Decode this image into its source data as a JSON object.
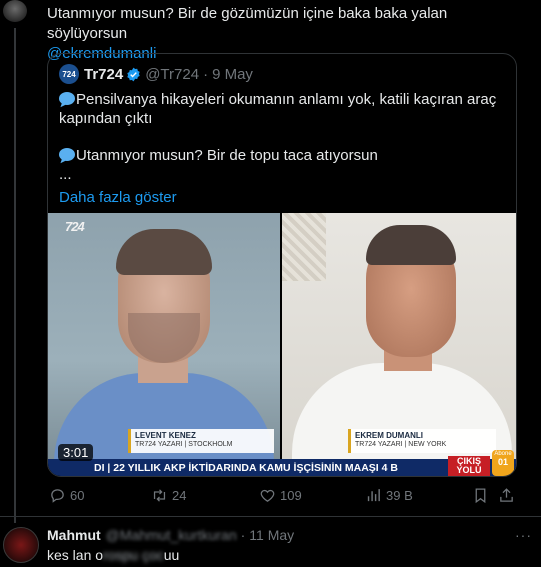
{
  "tweet": {
    "text": "Utanmıyor musun? Bir de gözümüzün içine baka baka yalan söylüyorsun",
    "mention": "@ekremdumanli"
  },
  "quote": {
    "logo_text": "724",
    "name": "Tr724",
    "handle": "@Tr724",
    "separator": "·",
    "date": "9 May",
    "line1": "Pensilvanya hikayeleri okumanın anlamı yok, katili kaçıran araç kapından çıktı",
    "line2": "Utanmıyor musun? Bir de topu taca atıyorsun",
    "ellipsis": "...",
    "show_more": "Daha fazla göster"
  },
  "video": {
    "channel_logo": "724",
    "duration": "3:01",
    "left_name": "LEVENT KENEZ",
    "left_role": "TR724 YAZARI | STOCKHOLM",
    "right_name": "EKREM DUMANLI",
    "right_role": "TR724 YAZARI | NEW YORK",
    "ticker": "DI | 22 YILLIK AKP İKTİDARINDA KAMU İŞÇİSİNİN MAAŞI 4 B",
    "badge_top": "ÇIKIŞ",
    "badge_bottom": "YOLU",
    "abone_label": "Abone",
    "abone_num": "01"
  },
  "actions": {
    "replies": "60",
    "reposts": "24",
    "likes": "109",
    "views": "39 B"
  },
  "reply": {
    "name": "Mahmut",
    "handle": "@Mahmut_kurtkuran",
    "separator": "·",
    "date": "11 May",
    "more": "···",
    "text_start": "kes lan o",
    "text_blurred": "rospu çoc",
    "text_end": "uu"
  }
}
